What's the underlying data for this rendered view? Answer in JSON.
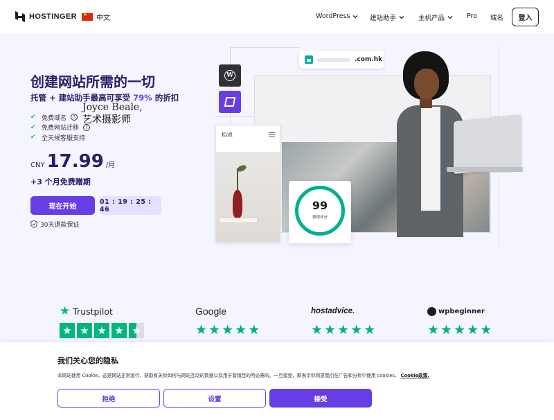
{
  "brand": {
    "name": "HOSTINGER"
  },
  "language": {
    "label": "中文",
    "icon": "china-flag-icon"
  },
  "nav": {
    "items": [
      {
        "label": "WordPress",
        "has_dropdown": true
      },
      {
        "label": "建站助手",
        "has_dropdown": true
      },
      {
        "label": "主机产品",
        "has_dropdown": true
      },
      {
        "label": "Pro",
        "has_dropdown": false
      },
      {
        "label": "域名",
        "has_dropdown": false
      }
    ],
    "login_label": "登入"
  },
  "hero": {
    "title": "创建网站所需的一切",
    "subtitle_prefix": "托管 + 建站助手最高可享受",
    "subtitle_highlight": "79%",
    "subtitle_suffix": "的折扣",
    "features": [
      {
        "label": "免费域名",
        "has_help": true
      },
      {
        "label": "免费网站迁移",
        "has_help": true
      },
      {
        "label": "全天候客服支持",
        "has_help": false
      }
    ],
    "price": {
      "currency": "CNY",
      "amount": "17.99",
      "period": "/月"
    },
    "bonus": "+3 个月免费赠期",
    "cta_label": "现在开始",
    "timer": "01 : 19 : 25 : 46",
    "guarantee": "30天退款保证"
  },
  "illustration": {
    "domain": ".com.hk",
    "site_brand": "Kofi",
    "site_name_line1": "Joyce Beale,",
    "site_name_line2": "艺术摄影师",
    "mobile_brand": "Kofi",
    "score_value": "99",
    "score_label": "表现评分"
  },
  "reviews": [
    {
      "brand": "Trustpilot",
      "icon": "trustpilot-star-icon",
      "rating": 4.5
    },
    {
      "brand": "Google",
      "rating": 5
    },
    {
      "brand": "hostadvice.",
      "rating": 5
    },
    {
      "brand": "wpbeginner",
      "icon": "wpbeginner-logo-icon",
      "rating": 5
    }
  ],
  "cookie": {
    "title": "我们关心您的隐私",
    "text": "本网站使用 Cookie，这是网站正常运行、获取有关你如何与网站互动的数据以及用于营销目的所必需的。一旦接受，即表示你同意我们在广告和分析中使用 cookies。",
    "link": "Cookie政策.",
    "reject_label": "拒绝",
    "settings_label": "设置",
    "accept_label": "接受"
  },
  "colors": {
    "brand_purple": "#673de6",
    "dark_purple": "#2f1c6a",
    "green": "#00b090",
    "trustpilot_green": "#00b67a"
  }
}
